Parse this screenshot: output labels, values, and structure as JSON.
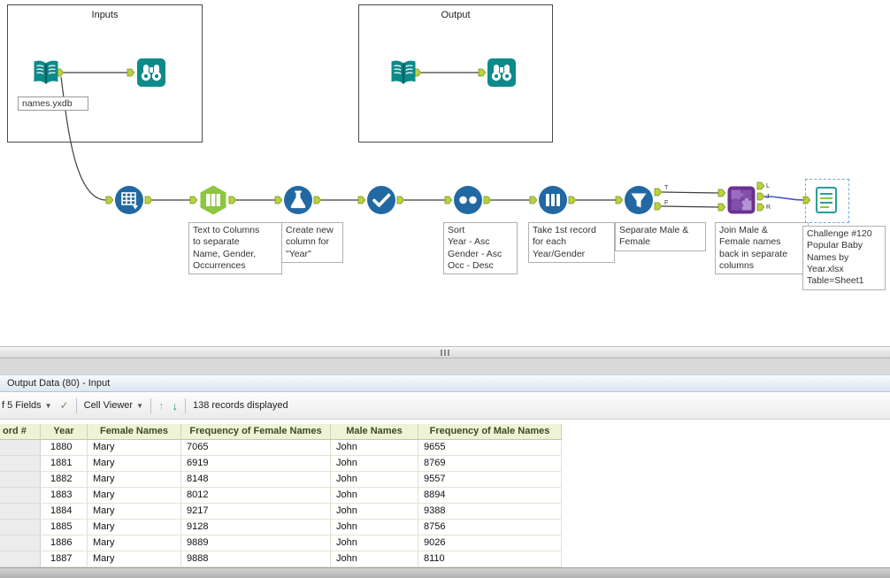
{
  "canvas": {
    "containers": [
      {
        "label": "Inputs"
      },
      {
        "label": "Output"
      }
    ],
    "input_file_label": "names.yxdb",
    "annotations": {
      "text_to_columns": "Text to Columns\nto separate\nName, Gender,\nOccurrences",
      "formula": "Create new\ncolumn for\n\"Year\"",
      "sort": "Sort\nYear - Asc\nGender - Asc\nOcc - Desc",
      "sample": "Take 1st record\nfor each\nYear/Gender",
      "filter": "Separate Male &\nFemale",
      "join": "Join Male &\nFemale names\nback in separate\ncolumns",
      "output": "Challenge #120\nPopular Baby\nNames by\nYear.xlsx\nTable=Sheet1"
    },
    "anchor_labels": {
      "t": "T",
      "f": "F",
      "l": "L",
      "j": "J",
      "r": "R"
    }
  },
  "results": {
    "panel_title": "Output Data (80) - Input",
    "fields_dropdown_label": "f 5 Fields",
    "cell_viewer_label": "Cell Viewer",
    "records_text": "138 records displayed",
    "table": {
      "columns": [
        "ord #",
        "Year",
        "Female Names",
        "Frequency of Female Names",
        "Male Names",
        "Frequency of Male Names"
      ],
      "rows": [
        [
          "1880",
          "Mary",
          "7065",
          "John",
          "9655"
        ],
        [
          "1881",
          "Mary",
          "6919",
          "John",
          "8769"
        ],
        [
          "1882",
          "Mary",
          "8148",
          "John",
          "9557"
        ],
        [
          "1883",
          "Mary",
          "8012",
          "John",
          "8894"
        ],
        [
          "1884",
          "Mary",
          "9217",
          "John",
          "9388"
        ],
        [
          "1885",
          "Mary",
          "9128",
          "John",
          "8756"
        ],
        [
          "1886",
          "Mary",
          "9889",
          "John",
          "9026"
        ],
        [
          "1887",
          "Mary",
          "9888",
          "John",
          "8110"
        ]
      ]
    }
  },
  "colors": {
    "teal": "#0d8a8a",
    "blue": "#2268a2",
    "green": "#8dc63f",
    "purple": "#6a3191",
    "anchor": "#b9d23c",
    "selected_wire": "#4553c8"
  }
}
